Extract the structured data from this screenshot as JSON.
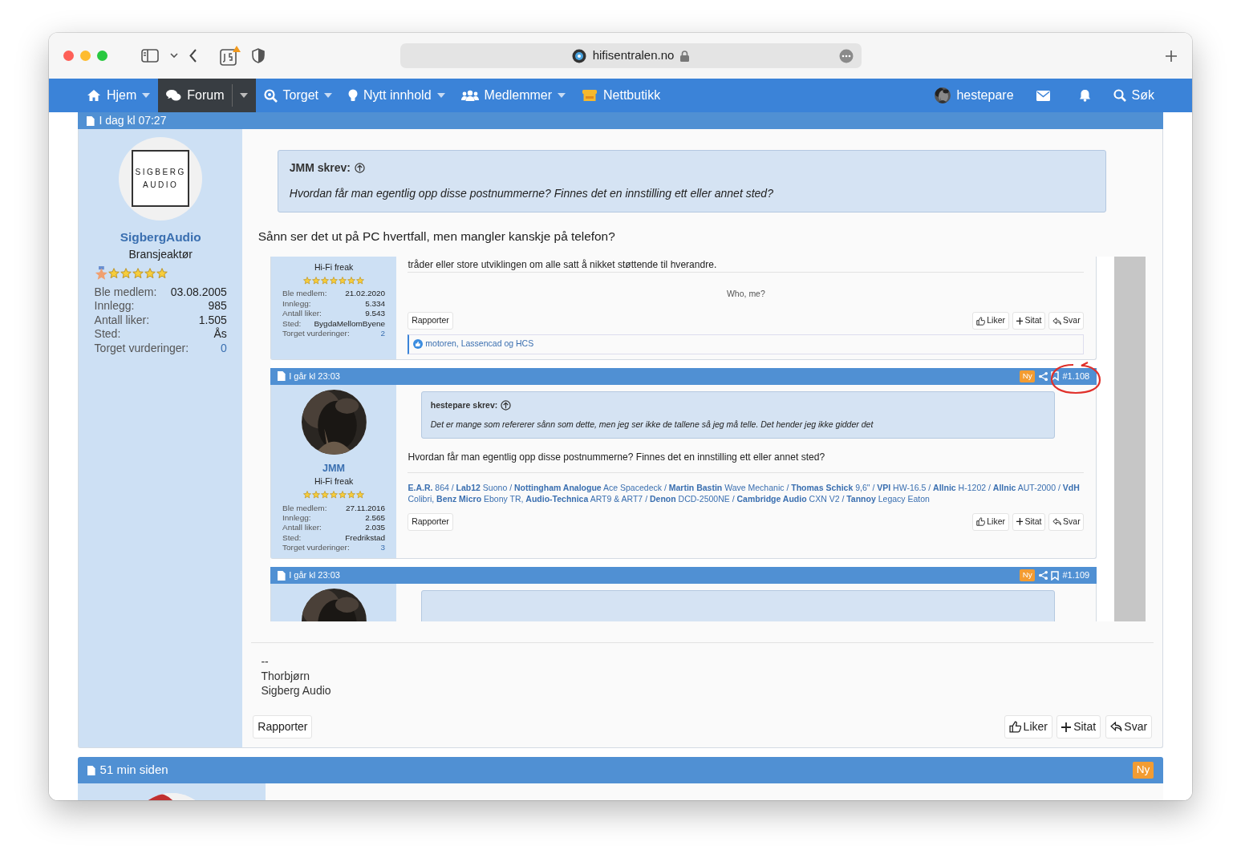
{
  "browser": {
    "url": "hifisentralen.no"
  },
  "nav": {
    "items": [
      {
        "label": "Hjem",
        "kind": "home",
        "dropdown": true,
        "selected": false
      },
      {
        "label": "Forum",
        "kind": "chat",
        "dropdown": true,
        "selected": true
      },
      {
        "label": "Torget",
        "kind": "market",
        "dropdown": true,
        "selected": false
      },
      {
        "label": "Nytt innhold",
        "kind": "bulb",
        "dropdown": true,
        "selected": false
      },
      {
        "label": "Medlemmer",
        "kind": "users",
        "dropdown": true,
        "selected": false
      },
      {
        "label": "Nettbutikk",
        "kind": "shop",
        "dropdown": false,
        "selected": false
      }
    ],
    "user": "hestepare",
    "search": "Søk"
  },
  "post": {
    "time": "I dag kl 07:27",
    "user": {
      "avatar": {
        "kind": "logo",
        "lines": [
          "SIGBERG",
          "AUDIO"
        ]
      },
      "name": "SigbergAudio",
      "title": "Bransjeaktør",
      "medal": true,
      "stars": 5,
      "stats": [
        {
          "label": "Ble medlem:",
          "value": "03.08.2005"
        },
        {
          "label": "Innlegg:",
          "value": "985"
        },
        {
          "label": "Antall liker:",
          "value": "1.505"
        },
        {
          "label": "Sted:",
          "value": "Ås"
        },
        {
          "label": "Torget vurderinger:",
          "value": "0",
          "link": true
        }
      ]
    },
    "quote": {
      "author": "JMM skrev:",
      "text": "Hvordan får man egentlig opp disse postnummerne? Finnes det en innstilling ett eller annet sted?"
    },
    "text": "Sånn ser det ut på PC hvertfall, men mangler kanskje på telefon?",
    "screenshot": {
      "posts": [
        {
          "user": {
            "title": "Hi-Fi freak",
            "stars": 7,
            "stats": [
              {
                "label": "Ble medlem:",
                "value": "21.02.2020"
              },
              {
                "label": "Innlegg:",
                "value": "5.334"
              },
              {
                "label": "Antall liker:",
                "value": "9.543"
              },
              {
                "label": "Sted:",
                "value": "BygdaMellomByene"
              },
              {
                "label": "Torget vurderinger:",
                "value": "2",
                "link": true
              }
            ]
          },
          "text": "tråder eller store utviklingen om alle satt å nikket støttende til hverandre.",
          "signature": "Who, me?",
          "report": "Rapporter",
          "buttons": [
            "Liker",
            "Sitat",
            "Svar"
          ],
          "reactions": "motoren, Lassencad og HCS"
        },
        {
          "time": "I går kl 23:03",
          "badge": "Ny",
          "number": "#1.108",
          "annotated": true,
          "user": {
            "name": "JMM",
            "title": "Hi-Fi freak",
            "stars": 7,
            "stats": [
              {
                "label": "Ble medlem:",
                "value": "27.11.2016"
              },
              {
                "label": "Innlegg:",
                "value": "2.565"
              },
              {
                "label": "Antall liker:",
                "value": "2.035"
              },
              {
                "label": "Sted:",
                "value": "Fredrikstad"
              },
              {
                "label": "Torget vurderinger:",
                "value": "3",
                "link": true
              }
            ]
          },
          "quote": {
            "author": "hestepare skrev:",
            "text": "Det er mange som refererer sånn som dette, men jeg ser ikke de tallene så jeg må telle. Det hender jeg ikke gidder det"
          },
          "text": "Hvordan får man egentlig opp disse postnummerne? Finnes det en innstilling ett eller annet sted?",
          "signature": "**E.A.R.** 864 / **Lab12** Suono / **Nottingham Analogue** Ace Spacedeck / **Martin Bastin** Wave Mechanic / **Thomas Schick** 9,6\" / **VPI** HW-16.5 / **Allnic** H-1202 / **Allnic** AUT-2000 / **VdH** Colibri, **Benz Micro** Ebony TR, **Audio-Technica** ART9 & ART7 / **Denon** DCD-2500NE / **Cambridge Audio** CXN V2 / **Tannoy** Legacy Eaton",
          "report": "Rapporter",
          "buttons": [
            "Liker",
            "Sitat",
            "Svar"
          ]
        },
        {
          "time": "I går kl 23:03",
          "badge": "Ny",
          "number": "#1.109",
          "annotated": false,
          "cut": true
        }
      ]
    },
    "signature": [
      "--",
      "Thorbjørn",
      "Sigberg Audio"
    ],
    "report": "Rapporter",
    "buttons": [
      "Liker",
      "Sitat",
      "Svar"
    ]
  },
  "next_post": {
    "time": "51 min siden",
    "badge": "Ny"
  }
}
